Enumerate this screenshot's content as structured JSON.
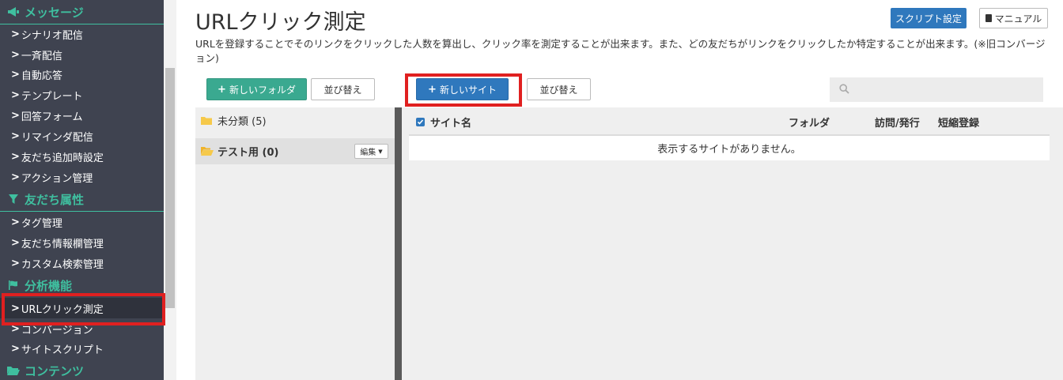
{
  "sidebar": {
    "sections": [
      {
        "label": "メッセージ",
        "icon": "megaphone-icon"
      },
      {
        "label": "友だち属性",
        "icon": "filter-icon"
      },
      {
        "label": "分析機能",
        "icon": "flag-icon"
      },
      {
        "label": "コンテンツ",
        "icon": "folder-open-icon"
      }
    ],
    "items": [
      {
        "label": "シナリオ配信"
      },
      {
        "label": "一斉配信"
      },
      {
        "label": "自動応答"
      },
      {
        "label": "テンプレート"
      },
      {
        "label": "回答フォーム"
      },
      {
        "label": "リマインダ配信"
      },
      {
        "label": "友だち追加時設定"
      },
      {
        "label": "アクション管理"
      },
      {
        "label": "タグ管理"
      },
      {
        "label": "友だち情報欄管理"
      },
      {
        "label": "カスタム検索管理"
      },
      {
        "label": "URLクリック測定"
      },
      {
        "label": "コンバージョン"
      },
      {
        "label": "サイトスクリプト"
      }
    ],
    "chevron": ">"
  },
  "header": {
    "title": "URLクリック測定",
    "script_button": "スクリプト設定",
    "manual_button": "マニュアル",
    "description": "URLを登録することでそのリンクをクリックした人数を算出し、クリック率を測定することが出来ます。また、どの友だちがリンクをクリックしたか特定することが出来ます。(※旧コンバージョン)"
  },
  "toolbar": {
    "new_folder": "新しいフォルダ",
    "sort_folders": "並び替え",
    "new_site": "新しいサイト",
    "sort_sites": "並び替え",
    "plus": "+",
    "search_placeholder": ""
  },
  "folders": [
    {
      "label": "未分類 (5)"
    },
    {
      "label": "テスト用 (0)"
    }
  ],
  "edit_button": "編集",
  "table": {
    "columns": [
      "サイト名",
      "フォルダ",
      "訪問/発行",
      "短縮登録"
    ],
    "empty_message": "表示するサイトがありません。"
  },
  "colors": {
    "sidebar_bg": "#3f4350",
    "accent_green": "#3fbf9f",
    "primary_blue": "#2f78bd",
    "highlight_red": "#e02020"
  }
}
